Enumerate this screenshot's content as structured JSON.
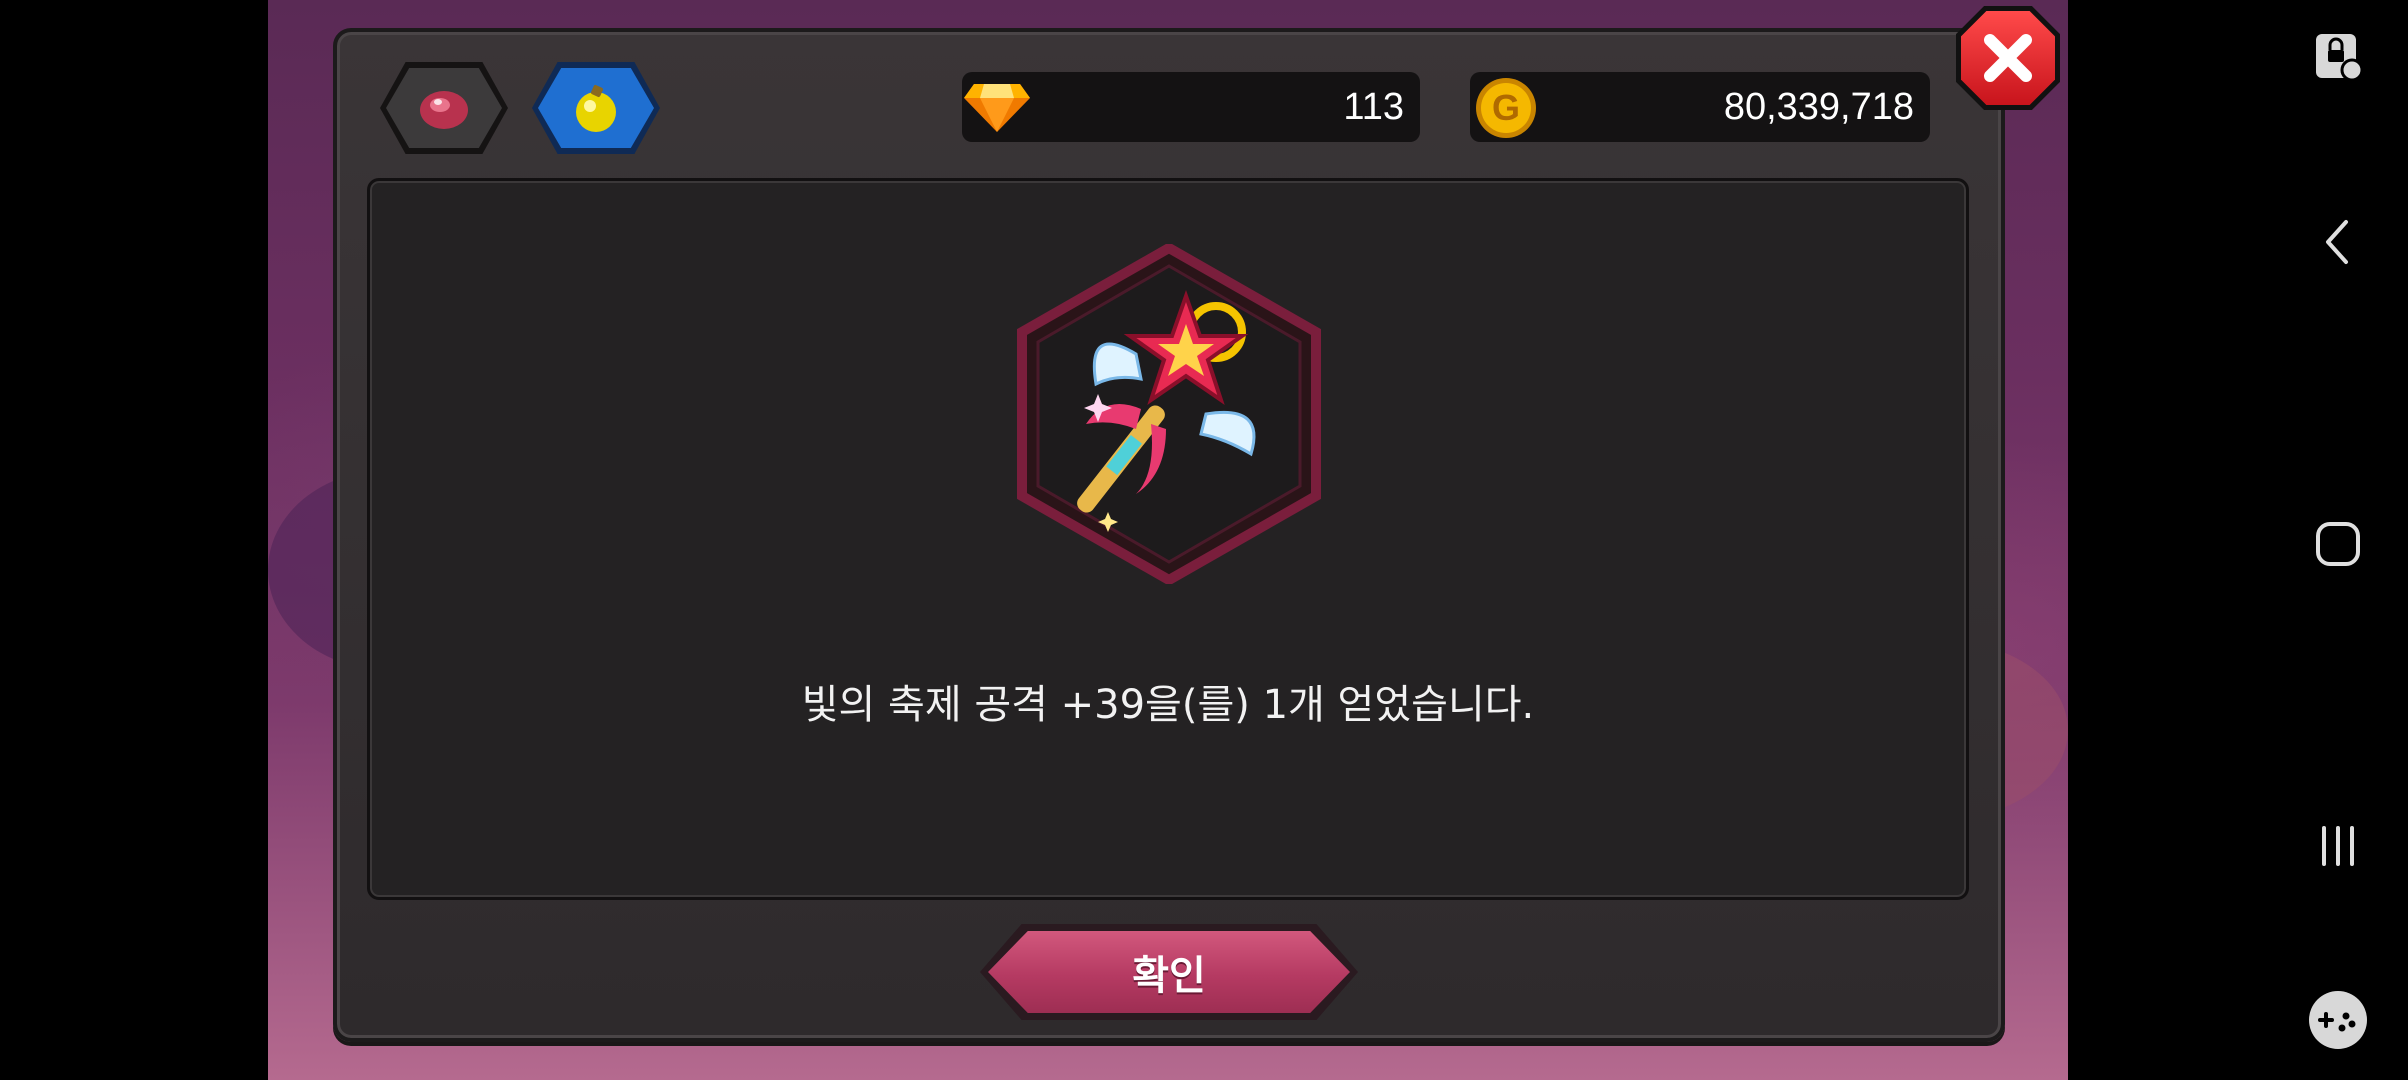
{
  "wallet": {
    "gems": "113",
    "gold": "80,339,718"
  },
  "dialog": {
    "message": "빛의 축제 공격 +39을(를) 1개 얻었습니다.",
    "confirm_label": "확인"
  },
  "tabs": [
    {
      "icon": "red-gem-icon",
      "color": "#3a3a3a"
    },
    {
      "icon": "yellow-bottle-icon",
      "color": "#1f6fd1"
    }
  ],
  "nav": {
    "buttons": [
      "screen-lock-icon",
      "back-icon",
      "home-icon",
      "recents-icon",
      "game-tools-icon"
    ]
  },
  "colors": {
    "accent_pink": "#b53a62",
    "close_red": "#d9151f",
    "gold": "#f5b800"
  }
}
